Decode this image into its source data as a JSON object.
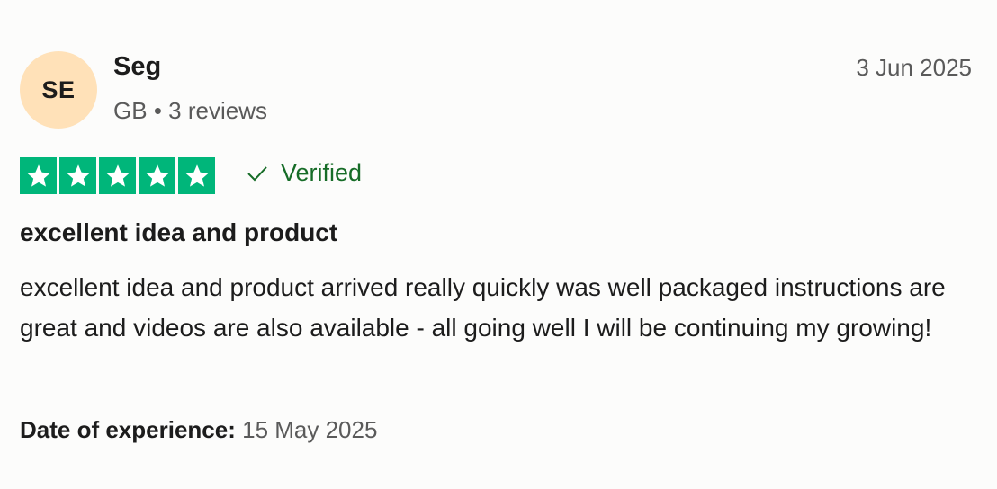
{
  "reviewer": {
    "initials": "SE",
    "name": "Seg",
    "country": "GB",
    "separator": "•",
    "review_count": "3 reviews"
  },
  "review": {
    "date": "3 Jun 2025",
    "rating": 5,
    "rating_max": 5,
    "star_color": "#00b67a",
    "verified_label": "Verified",
    "verified_color": "#166c27",
    "title": "excellent idea and product",
    "body": "excellent idea and product arrived really quickly was well packaged instructions are great and videos are also available - all going well I will be continuing my growing!",
    "experience_label": "Date of experience:",
    "experience_date": "15 May 2025"
  },
  "icons": {
    "star": "star-icon",
    "verified": "checkmark-icon"
  }
}
